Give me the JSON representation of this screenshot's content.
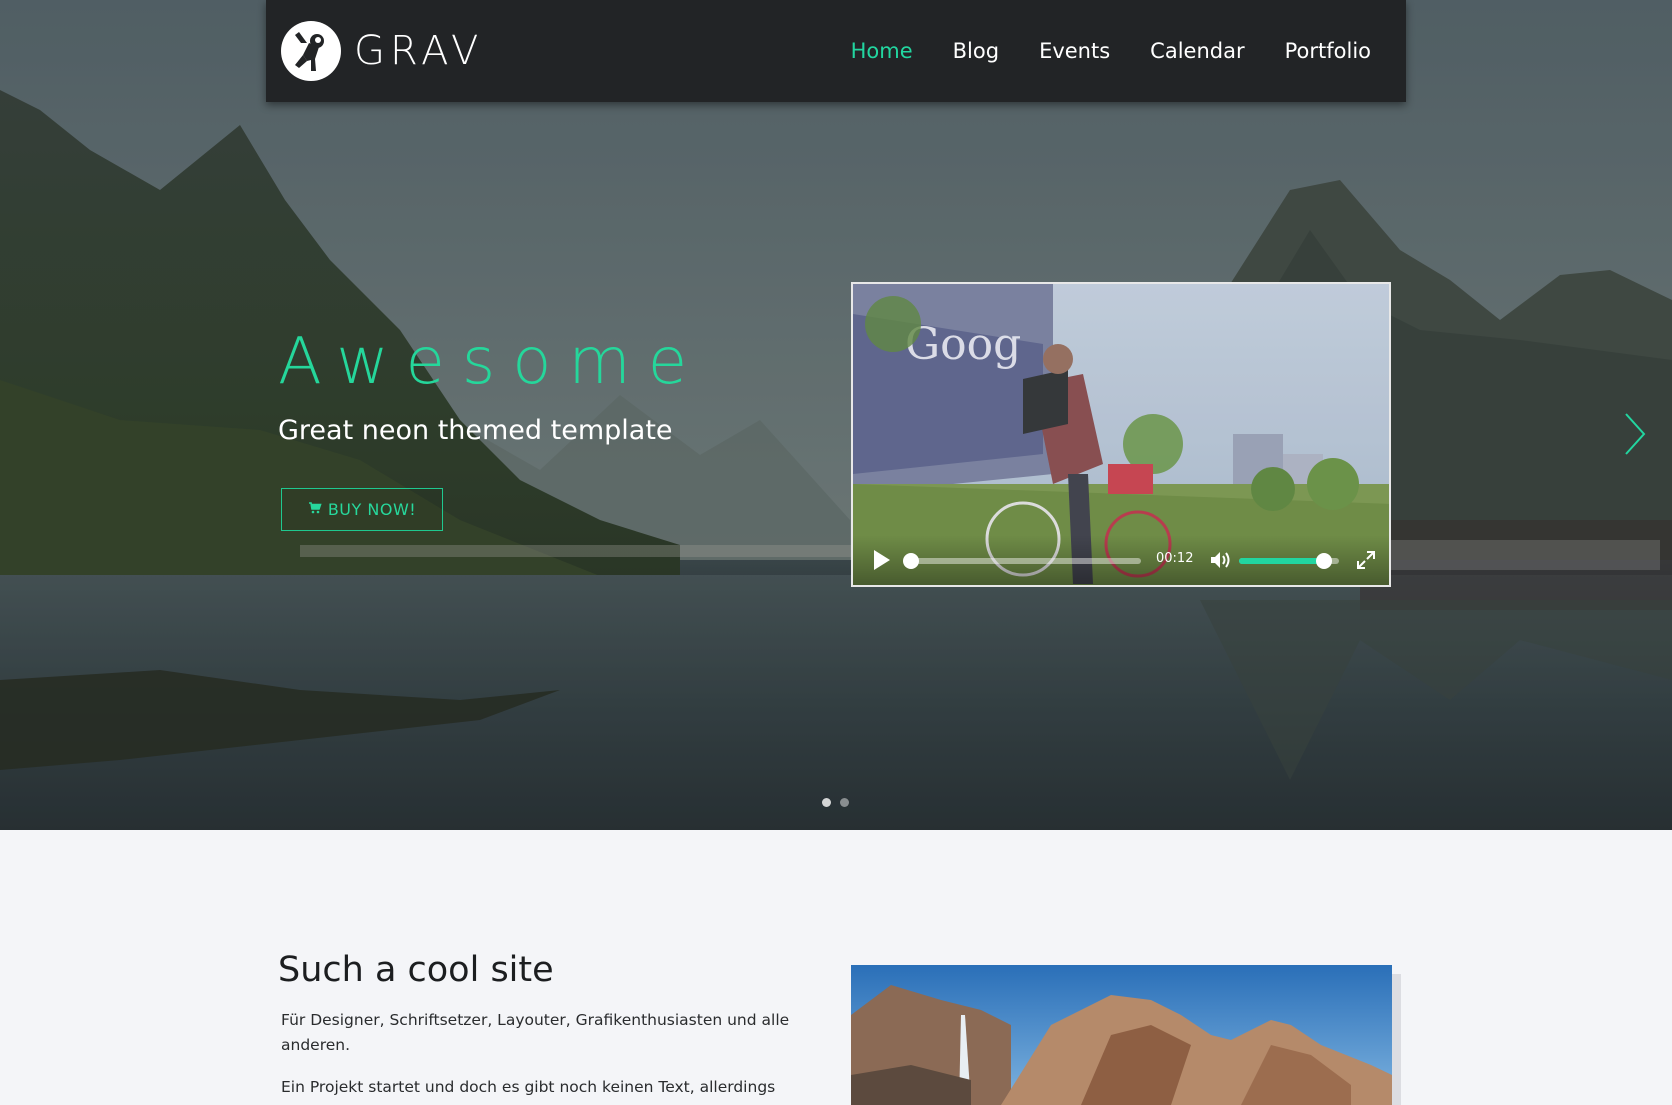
{
  "brand": {
    "name": "GRAV"
  },
  "nav": {
    "items": [
      {
        "label": "Home",
        "active": true
      },
      {
        "label": "Blog",
        "active": false
      },
      {
        "label": "Events",
        "active": false
      },
      {
        "label": "Calendar",
        "active": false
      },
      {
        "label": "Portfolio",
        "active": false
      }
    ]
  },
  "hero": {
    "title": "Awesome",
    "subtitle": "Great neon themed template",
    "cta_label": "BUY NOW!",
    "cta_icon": "cart-icon",
    "accent_color": "#22d6a0",
    "slides_total": 2,
    "active_slide": 1
  },
  "video": {
    "overlay_text": "Goog",
    "current_time": "00:12",
    "progress": 0.0,
    "volume": 0.85,
    "icons": [
      "play-icon",
      "volume-icon",
      "fullscreen-icon"
    ]
  },
  "section": {
    "title": "Such a cool site",
    "paragraph1": "Für Designer, Schriftsetzer, Layouter, Grafikenthusiasten und alle anderen.",
    "paragraph2": "Ein Projekt startet und doch es gibt noch keinen Text, allerdings sollte das"
  }
}
